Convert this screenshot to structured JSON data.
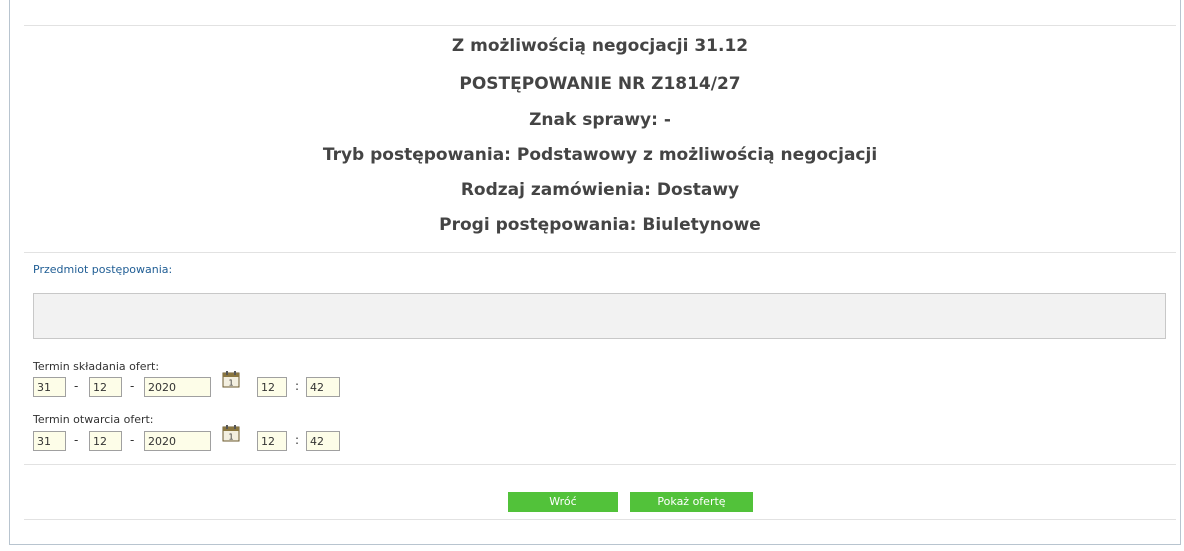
{
  "header": {
    "title": "Z możliwością negocjacji 31.12",
    "procedure_no": "POSTĘPOWANIE NR Z1814/27",
    "case_mark": "Znak sprawy: -",
    "mode": "Tryb postępowania: Podstawowy z możliwością negocjacji",
    "order_type": "Rodzaj zamówienia: Dostawy",
    "thresholds": "Progi postępowania: Biuletynowe"
  },
  "subject": {
    "label": "Przedmiot postępowania:",
    "value": ""
  },
  "submission_deadline": {
    "label": "Termin składania ofert:",
    "day": "31",
    "month": "12",
    "year": "2020",
    "hour": "12",
    "minute": "42"
  },
  "opening_deadline": {
    "label": "Termin otwarcia ofert:",
    "day": "31",
    "month": "12",
    "year": "2020",
    "hour": "12",
    "minute": "42"
  },
  "separators": {
    "date": "-",
    "time": ":"
  },
  "icons": {
    "calendar": "calendar-icon"
  },
  "buttons": {
    "back": "Wróć",
    "show_offer": "Pokaż ofertę"
  },
  "colors": {
    "accent_button": "#52c23a",
    "label_link": "#1f5d94",
    "input_bg": "#fdfde8"
  }
}
